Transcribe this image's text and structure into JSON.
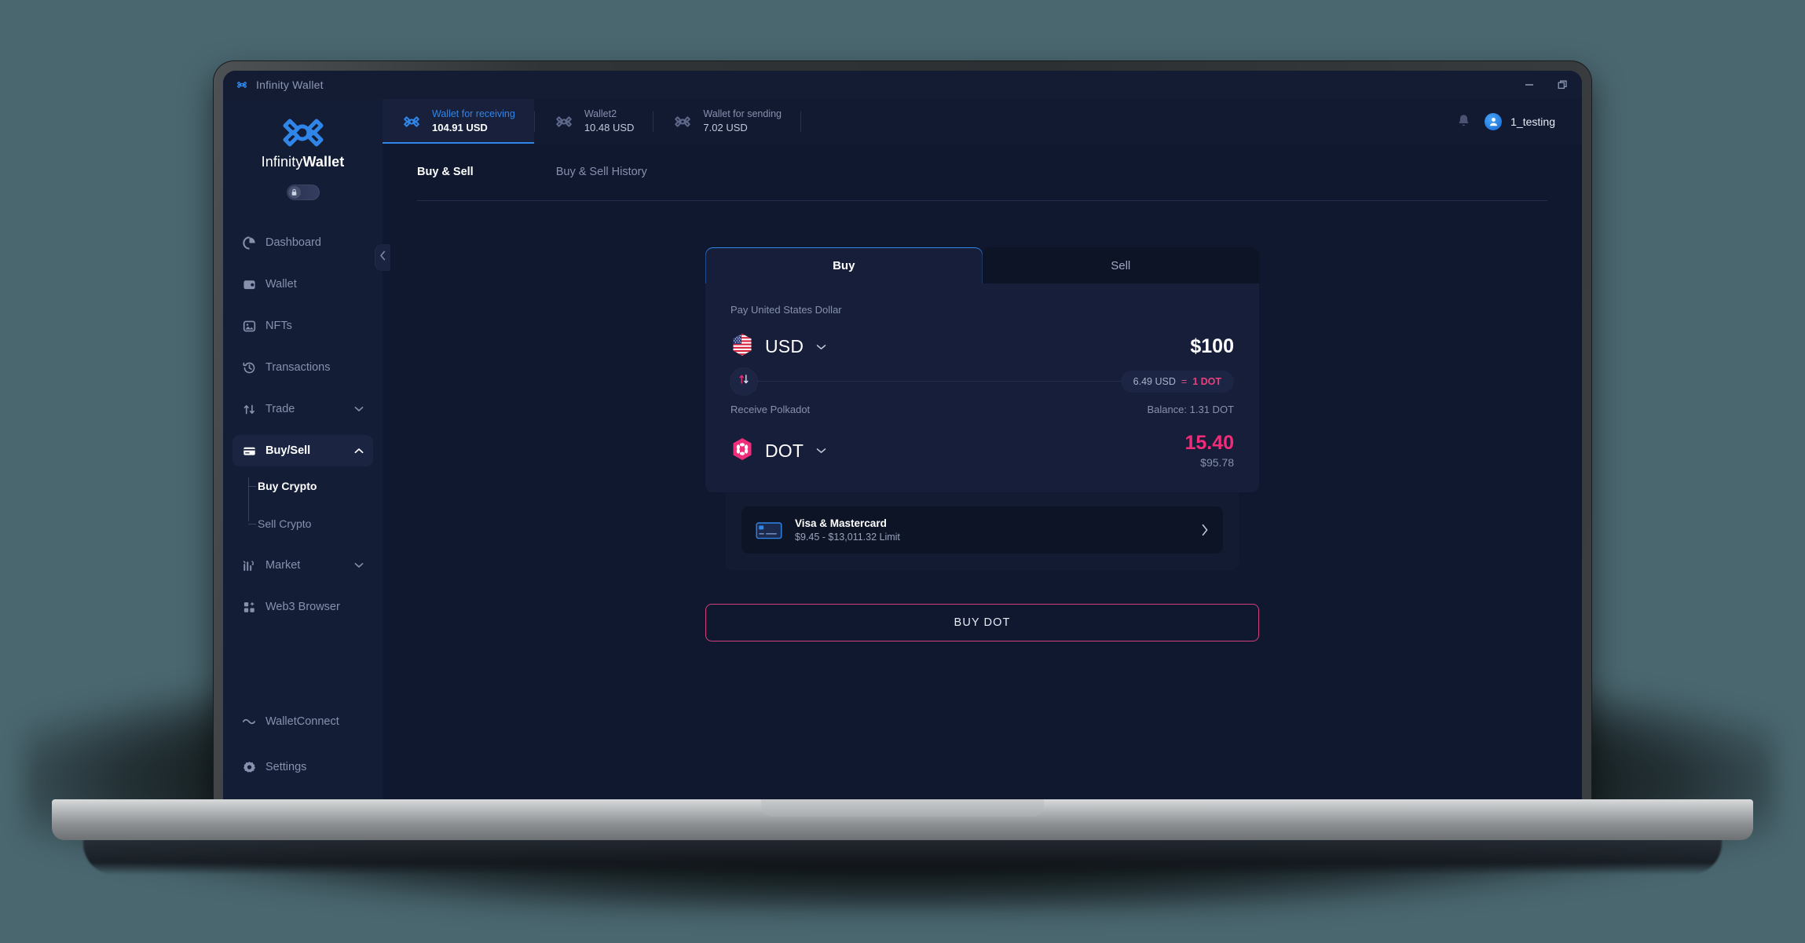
{
  "window": {
    "title": "Infinity Wallet",
    "controls": {
      "minimize": "minimize-icon",
      "maximize": "maximize-icon"
    }
  },
  "sidebar": {
    "brand_thin": "Infinity",
    "brand_bold": "Wallet",
    "lock_toggle": "lock-icon",
    "collapse": "chevron-left-icon",
    "items": [
      {
        "label": "Dashboard",
        "icon": "pie-chart-icon",
        "active": false,
        "expandable": false
      },
      {
        "label": "Wallet",
        "icon": "wallet-icon",
        "active": false,
        "expandable": false
      },
      {
        "label": "NFTs",
        "icon": "image-icon",
        "active": false,
        "expandable": false
      },
      {
        "label": "Transactions",
        "icon": "history-icon",
        "active": false,
        "expandable": false
      },
      {
        "label": "Trade",
        "icon": "swap-icon",
        "active": false,
        "expandable": true
      },
      {
        "label": "Buy/Sell",
        "icon": "credit-card-icon",
        "active": true,
        "expandable": true
      },
      {
        "label": "Market",
        "icon": "bar-chart-icon",
        "active": false,
        "expandable": true
      },
      {
        "label": "Web3 Browser",
        "icon": "grid-icon",
        "active": false,
        "expandable": false
      }
    ],
    "subitems": [
      {
        "label": "Buy Crypto",
        "active": true
      },
      {
        "label": "Sell Crypto",
        "active": false
      }
    ],
    "bottom_items": [
      {
        "label": "WalletConnect",
        "icon": "walletconnect-icon"
      },
      {
        "label": "Settings",
        "icon": "gear-icon"
      }
    ]
  },
  "wallet_bar": {
    "wallets": [
      {
        "name": "Wallet for receiving",
        "balance": "104.91 USD",
        "active": true
      },
      {
        "name": "Wallet2",
        "balance": "10.48 USD",
        "active": false
      },
      {
        "name": "Wallet for sending",
        "balance": "7.02 USD",
        "active": false
      }
    ],
    "notification_icon": "bell-icon",
    "user_name": "1_testing",
    "avatar_icon": "user-avatar-icon"
  },
  "content_tabs": [
    {
      "label": "Buy & Sell",
      "active": true
    },
    {
      "label": "Buy & Sell History",
      "active": false
    }
  ],
  "exchange": {
    "tabs": [
      {
        "label": "Buy",
        "active": true
      },
      {
        "label": "Sell",
        "active": false
      }
    ],
    "pay": {
      "label": "Pay United States Dollar",
      "symbol": "USD",
      "flag_icon": "us-flag-icon",
      "chevron_icon": "chevron-down-icon",
      "amount": "$100"
    },
    "swap_icon": "swap-vertical-icon",
    "rate": {
      "from": "6.49 USD",
      "equals": "=",
      "to": "1 DOT"
    },
    "receive": {
      "label": "Receive Polkadot",
      "balance": "Balance: 1.31 DOT",
      "symbol": "DOT",
      "token_icon": "polkadot-icon",
      "chevron_icon": "chevron-down-icon",
      "amount": "15.40",
      "fiat": "$95.78"
    },
    "payment_method": {
      "icon": "credit-card-icon",
      "title": "Visa & Mastercard",
      "limit": "$9.45 - $13,011.32 Limit",
      "chevron_icon": "chevron-right-icon"
    },
    "cta_label": "BUY DOT"
  },
  "colors": {
    "accent_blue": "#2f86e8",
    "accent_pink": "#ef2d79",
    "cta_border": "#d2407c",
    "sidebar_bg": "#141d36",
    "main_bg": "#101830",
    "card_bg": "#161e39",
    "page_bg": "#4a666f"
  }
}
